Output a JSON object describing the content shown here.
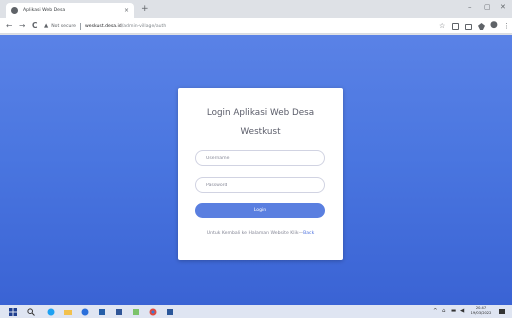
{
  "browser": {
    "tab_title": "Aplikasi Web Desa",
    "tab_close": "×",
    "new_tab": "+",
    "win_min": "–",
    "win_max": "▢",
    "win_close": "✕",
    "back": "←",
    "forward": "→",
    "reload": "C",
    "warn_icon": "▲",
    "security": "Not secure",
    "url_host": "weskust.desa.id",
    "url_path": "/admin-village/auth",
    "star_icon": "☆",
    "profile_icon": "●",
    "menu_icon": "⋮"
  },
  "login": {
    "title_line1": "Login Aplikasi Web Desa",
    "title_line2": "Westkust",
    "username_placeholder": "Username",
    "password_placeholder": "Password",
    "login_label": "Login",
    "back_text": "Untuk Kembali ke Halaman Website Klik—",
    "back_link": "Back"
  },
  "taskbar": {
    "time": "20.47",
    "date": "19/03/2022"
  },
  "colors": {
    "page_bg_top": "#5a82e6",
    "page_bg_bottom": "#3a63d4",
    "button": "#5a7fe0",
    "link": "#4e73df"
  }
}
